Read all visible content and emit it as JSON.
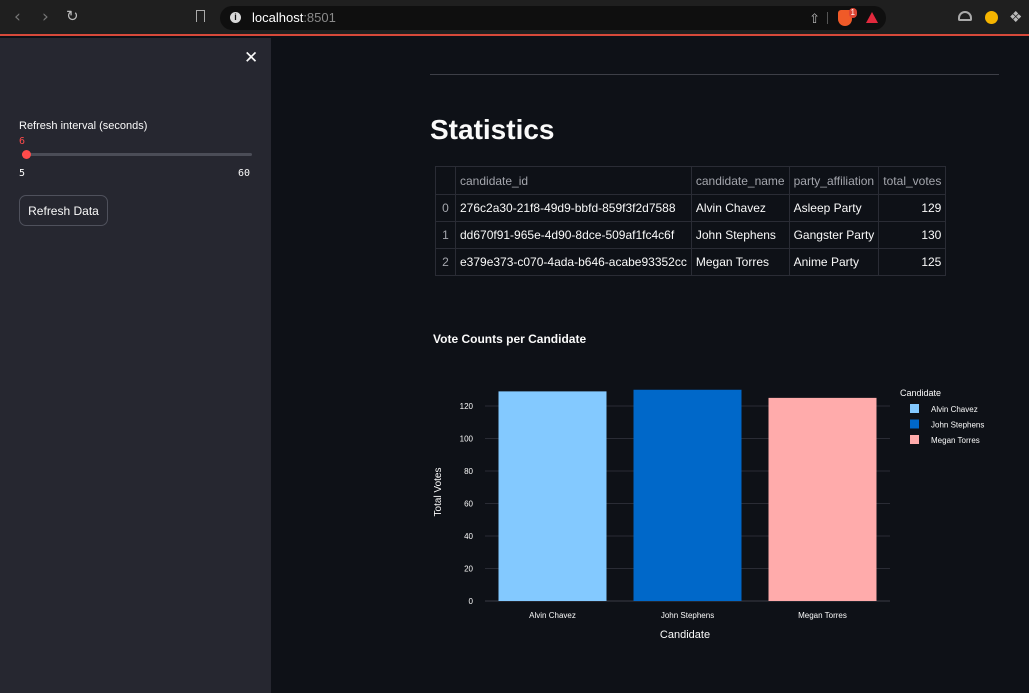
{
  "browser": {
    "url_host": "localhost",
    "url_port": ":8501",
    "brave_badge": "1"
  },
  "sidebar": {
    "slider": {
      "label": "Refresh interval (seconds)",
      "value": "6",
      "min": "5",
      "max": "60",
      "fraction": 0.0182
    },
    "refresh_button_label": "Refresh Data"
  },
  "main": {
    "title": "Statistics",
    "table": {
      "columns": [
        "",
        "candidate_id",
        "candidate_name",
        "party_affiliation",
        "total_votes"
      ],
      "rows": [
        [
          "0",
          "276c2a30-21f8-49d9-bbfd-859f3f2d7588",
          "Alvin Chavez",
          "Asleep Party",
          "129"
        ],
        [
          "1",
          "dd670f91-965e-4d90-8dce-509af1fc4c6f",
          "John Stephens",
          "Gangster Party",
          "130"
        ],
        [
          "2",
          "e379e373-c070-4ada-b646-acabe93352cc",
          "Megan Torres",
          "Anime Party",
          "125"
        ]
      ]
    }
  },
  "chart_data": {
    "type": "bar",
    "title": "Vote Counts per Candidate",
    "xlabel": "Candidate",
    "ylabel": "Total Votes",
    "categories": [
      "Alvin Chavez",
      "John Stephens",
      "Megan Torres"
    ],
    "values": [
      129,
      130,
      125
    ],
    "colors": [
      "#83c9ff",
      "#0068c9",
      "#ffabab"
    ],
    "yticks": [
      0,
      20,
      40,
      60,
      80,
      100,
      120
    ],
    "ylim": [
      0,
      136
    ],
    "grid": true,
    "legend": {
      "title": "Candidate",
      "position": "top-right",
      "entries": [
        "Alvin Chavez",
        "John Stephens",
        "Megan Torres"
      ]
    }
  }
}
